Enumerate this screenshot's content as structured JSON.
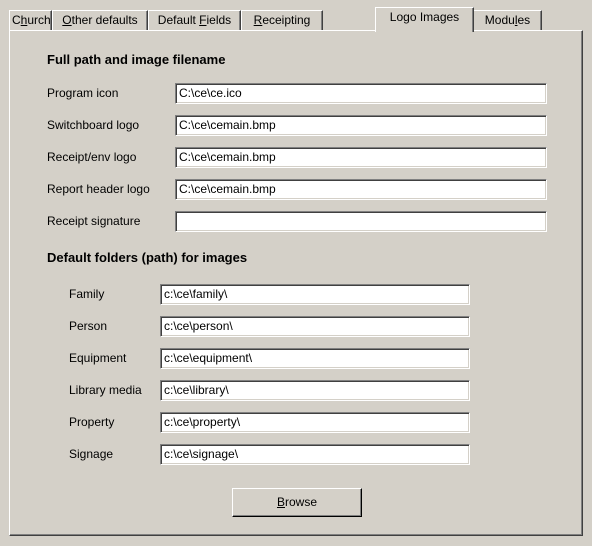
{
  "tabs": {
    "church": {
      "pre": "C",
      "key": "h",
      "post": "urch"
    },
    "other_defaults": {
      "pre": "",
      "key": "O",
      "post": "ther defaults"
    },
    "default_fields": {
      "pre": "Default ",
      "key": "F",
      "post": "ields"
    },
    "receipting": {
      "pre": "",
      "key": "R",
      "post": "eceipting"
    },
    "logo_images": {
      "pre": "Logo Images",
      "key": "",
      "post": ""
    },
    "modules": {
      "pre": "Modu",
      "key": "l",
      "post": "es"
    }
  },
  "section_full_path": {
    "heading": "Full path and image filename",
    "fields": {
      "program_icon": {
        "label": "Program icon",
        "value": "C:\\ce\\ce.ico"
      },
      "switchboard_logo": {
        "label": "Switchboard logo",
        "value": "C:\\ce\\cemain.bmp"
      },
      "receipt_env_logo": {
        "label": "Receipt/env logo",
        "value": "C:\\ce\\cemain.bmp"
      },
      "report_header_logo": {
        "label": "Report header logo",
        "value": "C:\\ce\\cemain.bmp"
      },
      "receipt_signature": {
        "label": "Receipt signature",
        "value": ""
      }
    }
  },
  "section_folders": {
    "heading": "Default folders (path) for images",
    "fields": {
      "family": {
        "label": "Family",
        "value": "c:\\ce\\family\\"
      },
      "person": {
        "label": "Person",
        "value": "c:\\ce\\person\\"
      },
      "equipment": {
        "label": "Equipment",
        "value": "c:\\ce\\equipment\\"
      },
      "library_media": {
        "label": "Library media",
        "value": "c:\\ce\\library\\"
      },
      "property": {
        "label": "Property",
        "value": "c:\\ce\\property\\"
      },
      "signage": {
        "label": "Signage",
        "value": "c:\\ce\\signage\\"
      }
    }
  },
  "browse_button": {
    "pre": "",
    "key": "B",
    "post": "rowse"
  }
}
